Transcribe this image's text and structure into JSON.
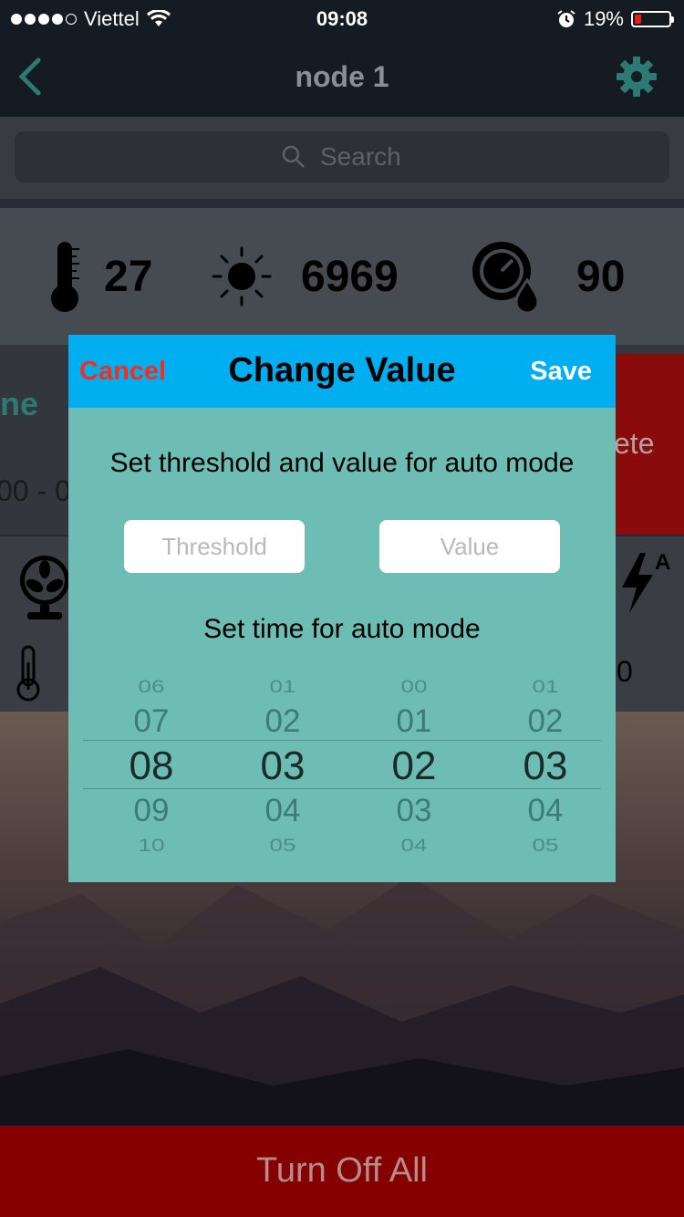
{
  "status_bar": {
    "carrier": "Viettel",
    "time": "09:08",
    "battery": "19%",
    "battery_level": 0.19,
    "signal_bars": 4
  },
  "nav": {
    "title": "node 1",
    "back_icon": "chevron-left-icon",
    "settings_icon": "gear-icon"
  },
  "search": {
    "placeholder": "Search"
  },
  "sensors": [
    {
      "icon": "thermometer-icon",
      "value": "27"
    },
    {
      "icon": "sun-icon",
      "value": "6969"
    },
    {
      "icon": "humidity-gauge-icon",
      "value": "90"
    }
  ],
  "background_row": {
    "partial_name": "ne",
    "partial_time": "00 - 0",
    "partial_action": "ete",
    "partial_value": "0"
  },
  "modal": {
    "cancel_label": "Cancel",
    "title": "Change Value",
    "save_label": "Save",
    "threshold_label": "Set threshold and value for auto mode",
    "threshold_placeholder": "Threshold",
    "value_placeholder": "Value",
    "time_label": "Set time for auto mode",
    "picker_columns": [
      {
        "rows": [
          "06",
          "07",
          "08",
          "09",
          "10"
        ]
      },
      {
        "rows": [
          "01",
          "02",
          "03",
          "04",
          "05"
        ]
      },
      {
        "rows": [
          "00",
          "01",
          "02",
          "03",
          "04"
        ]
      },
      {
        "rows": [
          "01",
          "02",
          "03",
          "04",
          "05"
        ]
      }
    ]
  },
  "bottom_button": {
    "label": "Turn Off All"
  },
  "colors": {
    "modal_header": "#01aef0",
    "modal_body": "#6dbdb5",
    "cancel": "#f22f1e",
    "bottom_button": "#850000"
  }
}
